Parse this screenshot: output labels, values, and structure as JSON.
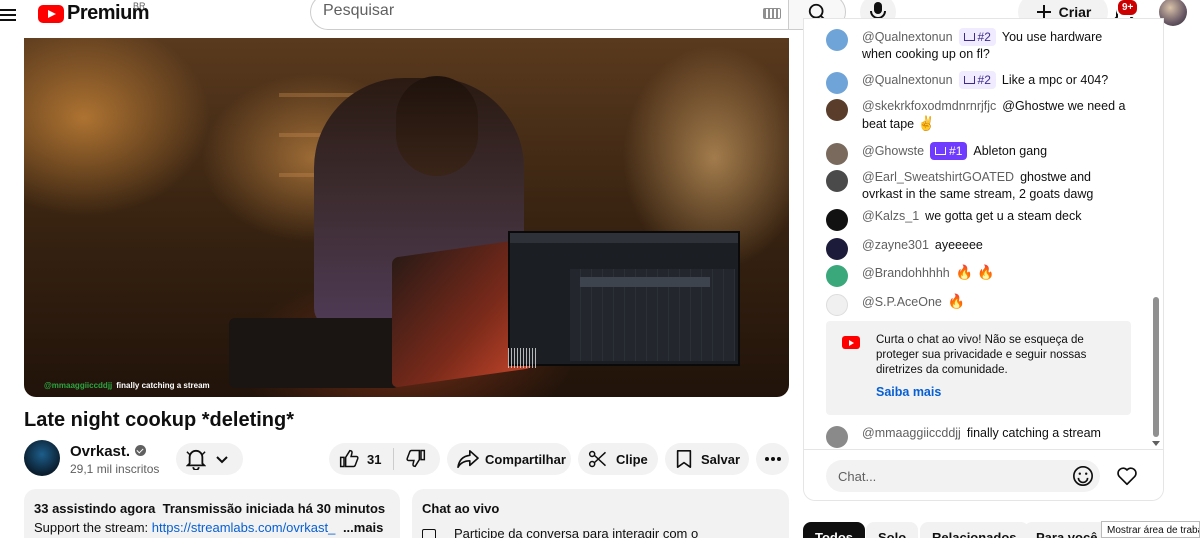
{
  "header": {
    "logo_text": "Premium",
    "logo_region": "BR",
    "search_placeholder": "Pesquisar",
    "create_label": "Criar",
    "notification_count": "9+"
  },
  "video": {
    "overlay_user": "@mmaaggiiccddjj",
    "overlay_text": "finally catching a stream",
    "title": "Late night cookup *deleting*"
  },
  "channel": {
    "name": "Ovrkast.",
    "subscribers": "29,1 mil inscritos"
  },
  "actions": {
    "likes": "31",
    "share": "Compartilhar",
    "clip": "Clipe",
    "save": "Salvar"
  },
  "description": {
    "watching": "33 assistindo agora",
    "started": "Transmissão iniciada há 30 minutos",
    "support_prefix": "Support the stream:",
    "link": "https://streamlabs.com/ovrkast_",
    "more": "...mais"
  },
  "live_chat_collapsed": {
    "title": "Chat ao vivo",
    "prompt": "Participe da conversa para interagir com o"
  },
  "chat": {
    "messages": [
      {
        "author": "@Qualnextonun",
        "badge": "#2",
        "text": "You use hardware when cooking up on fl?"
      },
      {
        "author": "@Qualnextonun",
        "badge": "#2",
        "text": "Like a mpc or 404?"
      },
      {
        "author": "@skekrkfoxodmdnrnrjfjc",
        "badge": "",
        "text": "@Ghostwe we need a beat tape",
        "emoji": "✌"
      },
      {
        "author": "@Ghowste",
        "badge": "#1",
        "text": "Ableton gang"
      },
      {
        "author": "@Earl_SweatshirtGOATED",
        "badge": "",
        "text": "ghostwe and ovrkast in the same stream, 2 goats dawg"
      },
      {
        "author": "@Kalzs_1",
        "badge": "",
        "text": "we gotta get u a steam deck"
      },
      {
        "author": "@zayne301",
        "badge": "",
        "text": "ayeeeee"
      },
      {
        "author": "@Brandohhhhh",
        "badge": "",
        "text": "",
        "emoji": "🔥 🔥"
      },
      {
        "author": "@S.P.AceOne",
        "badge": "",
        "text": "",
        "emoji": "🔥"
      },
      {
        "author": "@mmaaggiiccddjj",
        "badge": "",
        "text": "finally catching a stream"
      }
    ],
    "notice_text": "Curta o chat ao vivo! Não se esqueça de proteger sua privacidade e seguir nossas diretrizes da comunidade.",
    "notice_link": "Saiba mais",
    "input_placeholder": "Chat..."
  },
  "chips": [
    "Todos",
    "Solo",
    "Relacionados",
    "Para você"
  ],
  "tooltip": "Mostrar área de traba",
  "colors": {
    "brand_red": "#ff0000",
    "badge_purple": "#6f3cff",
    "link_blue": "#065fd4"
  },
  "icons": {
    "menu": "menu-icon",
    "search": "search-icon",
    "mic": "mic-icon",
    "create": "plus-icon",
    "bell": "bell-icon",
    "like": "thumbs-up-icon",
    "dislike": "thumbs-down-icon",
    "share": "share-arrow-icon",
    "clip": "scissors-icon",
    "save": "bookmark-icon",
    "more": "more-horiz-icon",
    "emoji": "smiley-icon",
    "heart": "heart-icon"
  }
}
